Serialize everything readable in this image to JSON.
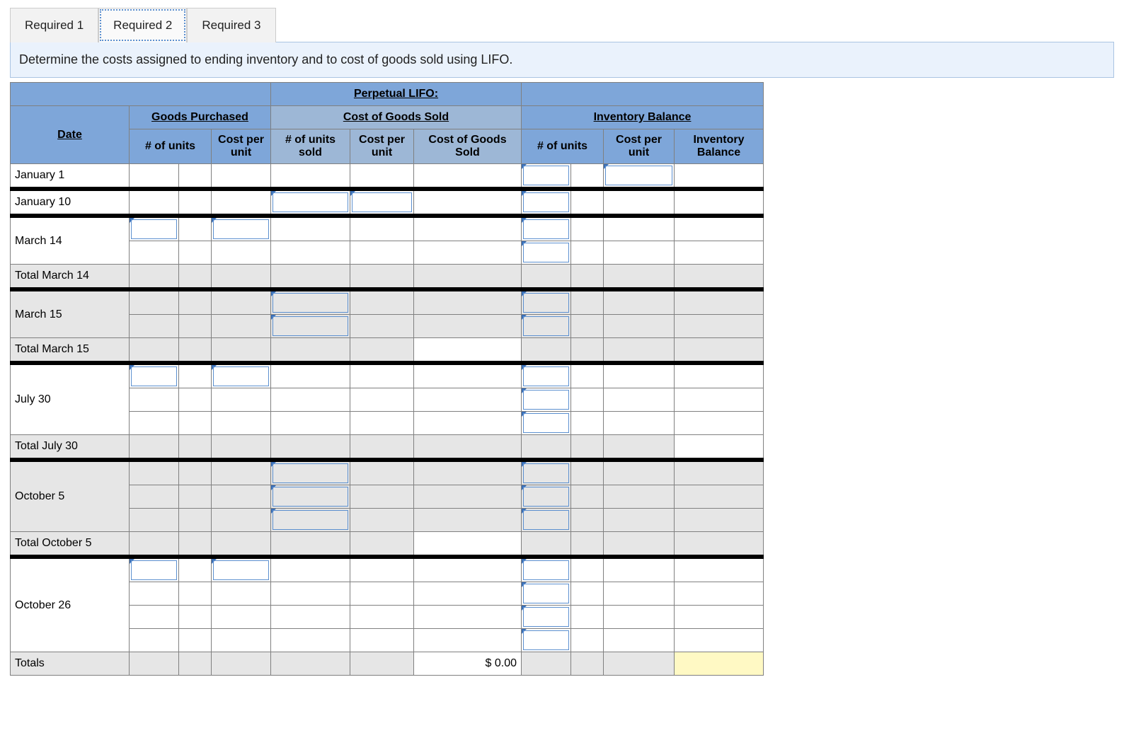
{
  "tabs": {
    "t1": "Required 1",
    "t2": "Required 2",
    "t3": "Required 3"
  },
  "instructions": "Determine the costs assigned to ending inventory and to cost of goods sold using LIFO.",
  "titles": {
    "main": "Perpetual LIFO:",
    "date": "Date",
    "goods_purchased": "Goods Purchased",
    "cogs": "Cost of Goods Sold",
    "inventory_balance": "Inventory Balance",
    "num_units": "# of units",
    "cost_per_unit": "Cost per unit",
    "num_units_sold": "# of units sold",
    "cogs_total": "Cost of Goods Sold",
    "inv_bal": "Inventory Balance"
  },
  "rows": {
    "r1": "January 1",
    "r2": "January 10",
    "r3": "March 14",
    "r4": "Total March 14",
    "r5": "March 15",
    "r6": "Total March 15",
    "r7": "July 30",
    "r8": "Total July 30",
    "r9": "October 5",
    "r10": "Total October 5",
    "r11": "October 26",
    "r12": "Totals"
  },
  "totals_value": "$          0.00"
}
